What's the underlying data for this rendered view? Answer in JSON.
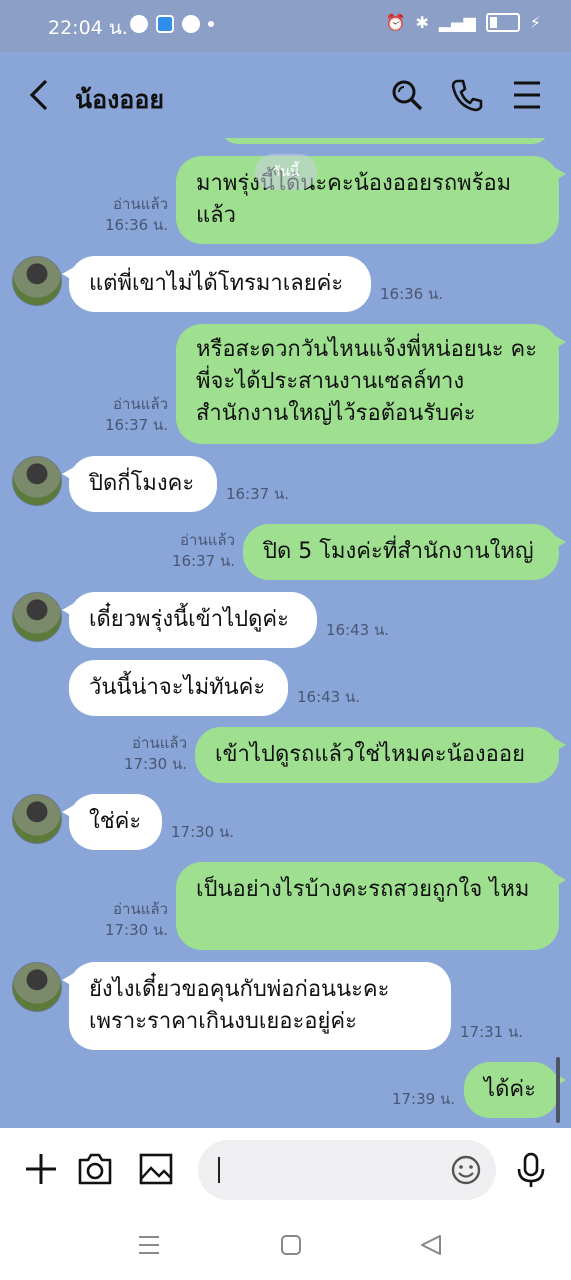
{
  "status": {
    "time": "22:04 น."
  },
  "header": {
    "title": "น้องออย"
  },
  "chat": {
    "date_chip": "วันนี้",
    "messages": [
      {
        "text": "มาพรุ่งนี้ได้นะคะน้องออยรถพร้อม แล้ว",
        "read": "อ่านแล้ว",
        "time": "16:36 น."
      },
      {
        "text": "แต่พี่เขาไม่ได้โทรมาเลยค่ะ",
        "time": "16:36 น."
      },
      {
        "text": "หรือสะดวกวันไหนแจ้งพี่หน่อยนะ คะพี่จะได้ประสานงานเซลล์ทาง สำนักงานใหญ่ไว้รอต้อนรับค่ะ",
        "read": "อ่านแล้ว",
        "time": "16:37 น."
      },
      {
        "text": "ปิดกี่โมงคะ",
        "time": "16:37 น."
      },
      {
        "text": "ปิด 5 โมงค่ะที่สำนักงานใหญ่",
        "read": "อ่านแล้ว",
        "time": "16:37 น."
      },
      {
        "text": "เดี๋ยวพรุ่งนี้เข้าไปดูค่ะ",
        "time": "16:43 น."
      },
      {
        "text": "วันนี้น่าจะไม่ทันค่ะ",
        "time": "16:43 น."
      },
      {
        "text": "เข้าไปดูรถแล้วใช่ไหมคะน้องออย",
        "read": "อ่านแล้ว",
        "time": "17:30 น."
      },
      {
        "text": "ใช่ค่ะ",
        "time": "17:30 น."
      },
      {
        "text": "เป็นอย่างไรบ้างคะรถสวยถูกใจ ไหม",
        "read": "อ่านแล้ว",
        "time": "17:30 น."
      },
      {
        "text": "ยังไงเดี๋ยวขอคุนกับพ่อก่อนนะคะ เพราะราคาเกินงบเยอะอยู่ค่ะ",
        "time": "17:31 น."
      },
      {
        "text": "ได้ค่ะ",
        "time": "17:39 น."
      }
    ]
  },
  "icons": {
    "back": "chevron-left-icon",
    "search": "search-icon",
    "call": "phone-icon",
    "menu": "menu-icon",
    "add": "plus-icon",
    "camera": "camera-icon",
    "gallery": "image-icon",
    "emoji": "emoji-icon",
    "mic": "mic-icon"
  },
  "colors": {
    "background": "#8aa6d8",
    "outgoing": "#9ee08f",
    "incoming": "#ffffff"
  }
}
